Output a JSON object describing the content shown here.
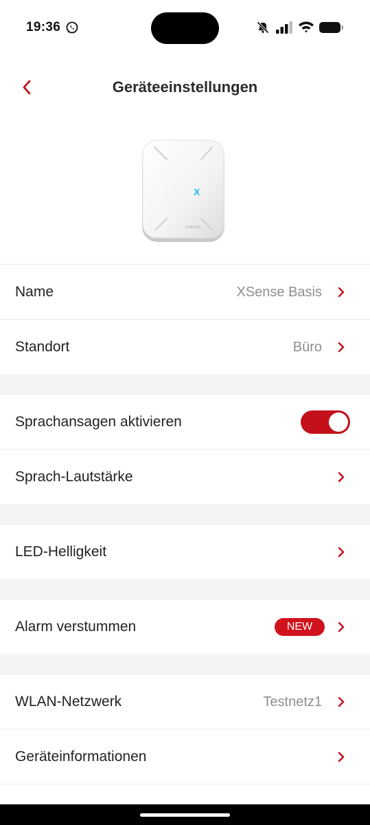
{
  "status": {
    "time": "19:36",
    "icons": [
      "whatsapp-icon",
      "mute-icon",
      "signal-icon",
      "wifi-icon",
      "battery-icon"
    ]
  },
  "header": {
    "title": "Geräteeinstellungen",
    "back_icon": "chevron-left-icon"
  },
  "device": {
    "image": "smoke-alarm-base-station",
    "brand_mark": "X",
    "label": "X-SENSE"
  },
  "groups": [
    {
      "rows": [
        {
          "label": "Name",
          "value": "XSense Basis"
        },
        {
          "label": "Standort",
          "value": "Büro"
        }
      ]
    },
    {
      "rows": [
        {
          "label": "Sprachansagen aktivieren",
          "toggle": true
        },
        {
          "label": "Sprach-Lautstärke"
        }
      ]
    },
    {
      "rows": [
        {
          "label": "LED-Helligkeit"
        }
      ]
    },
    {
      "rows": [
        {
          "label": "Alarm verstummen",
          "badge": "NEW"
        }
      ]
    },
    {
      "rows": [
        {
          "label": "WLAN-Netzwerk",
          "value": "Testnetz1"
        },
        {
          "label": "Geräteinformationen"
        }
      ]
    }
  ],
  "colors": {
    "accent": "#c4101a",
    "badge": "#d0121c",
    "separator_bg": "#f4f4f4",
    "value_text": "#8e8e8e"
  }
}
